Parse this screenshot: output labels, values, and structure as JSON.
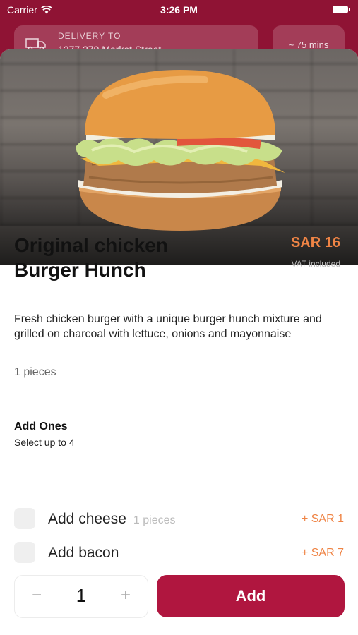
{
  "status_bar": {
    "carrier": "Carrier",
    "time": "3:26 PM"
  },
  "delivery": {
    "label": "DELIVERY TO",
    "address": "1277 279 Market Street",
    "eta": "~ 75 mins"
  },
  "product": {
    "title": "Original chicken Burger Hunch",
    "price": "SAR 16",
    "vat_note": "VAT included",
    "description": "Fresh chicken burger with a unique burger hunch mixture and grilled on charcoal with lettuce, onions and mayonnaise",
    "pieces": "1 pieces"
  },
  "addons": {
    "title": "Add Ones",
    "subtitle": "Select up to 4",
    "items": [
      {
        "name": "Add cheese",
        "qty": "1 pieces",
        "price": "+  SAR 1"
      },
      {
        "name": "Add bacon",
        "qty": "",
        "price": "+  SAR 7"
      }
    ]
  },
  "footer": {
    "minus": "−",
    "quantity": "1",
    "plus": "+",
    "add_label": "Add"
  },
  "colors": {
    "brand": "#b0163f",
    "accent": "#ef8445",
    "header_bg": "#8f1334"
  },
  "icons": [
    "wifi-icon",
    "battery-icon",
    "delivery-truck-icon",
    "chevron-down-icon",
    "checkbox-icon"
  ]
}
